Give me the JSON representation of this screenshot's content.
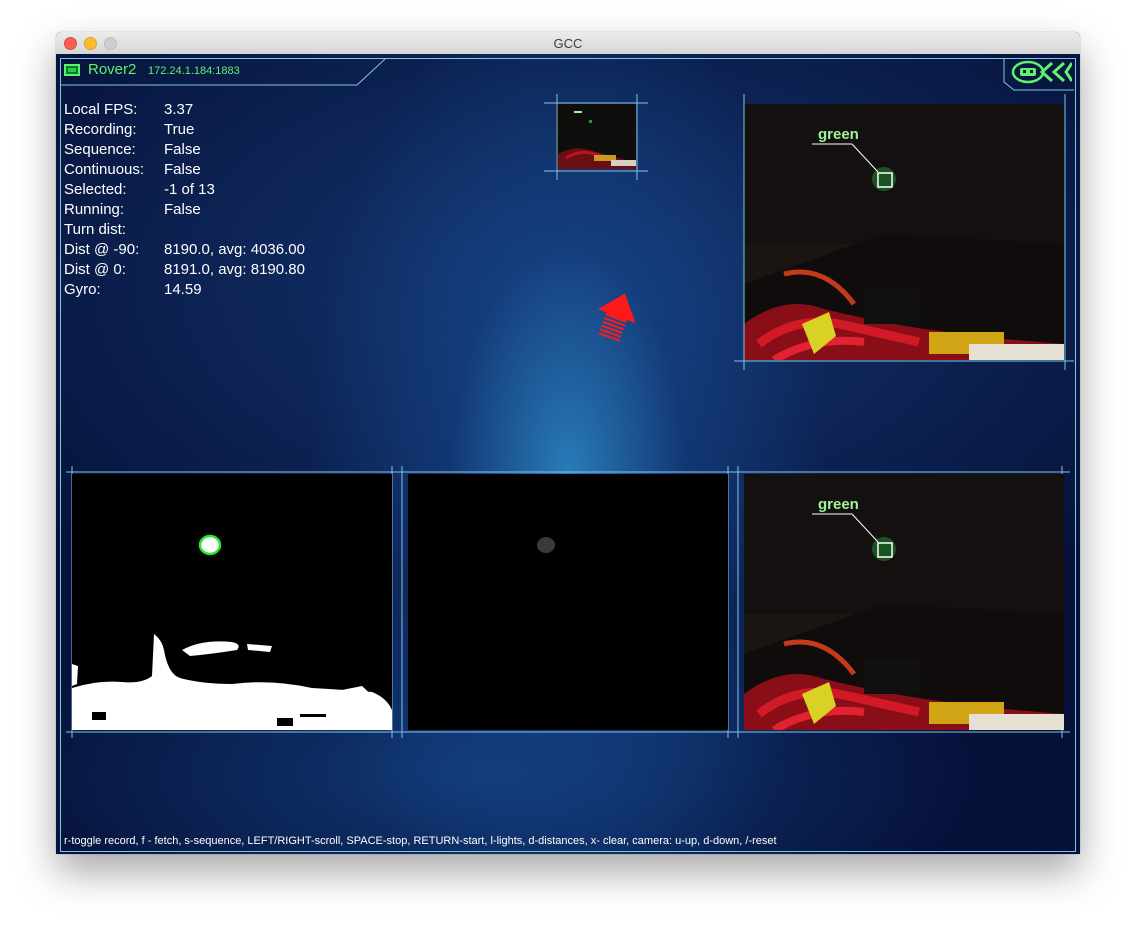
{
  "window": {
    "title": "GCC"
  },
  "header": {
    "robot_name": "Rover2",
    "address": "172.24.1.184:1883",
    "logo": "gcc-logo-icon"
  },
  "info": {
    "rows": [
      {
        "label": "Local FPS:",
        "value": "3.37"
      },
      {
        "label": "Recording:",
        "value": "True"
      },
      {
        "label": "Sequence:",
        "value": "False"
      },
      {
        "label": "Continuous:",
        "value": "False"
      },
      {
        "label": "Selected:",
        "value": "-1 of 13"
      },
      {
        "label": "Running:",
        "value": "False"
      },
      {
        "label": "Turn dist:",
        "value": ""
      },
      {
        "label": "Dist @ -90:",
        "value": "8190.0, avg: 4036.00"
      },
      {
        "label": "Dist @ 0:",
        "value": "8191.0, avg: 8190.80"
      },
      {
        "label": "Gyro:",
        "value": "14.59"
      }
    ]
  },
  "panels": {
    "camera_top_label": "green",
    "camera_bottom_label": "green"
  },
  "colors": {
    "accent_green": "#5ff26d",
    "frame_line": "#7fc6e0",
    "arrow_red": "#ff1a1a"
  },
  "footer": {
    "help": "r-toggle record, f - fetch, s-sequence, LEFT/RIGHT-scroll, SPACE-stop, RETURN-start, l-lights, d-distances, x- clear, camera: u-up, d-down, /-reset"
  }
}
